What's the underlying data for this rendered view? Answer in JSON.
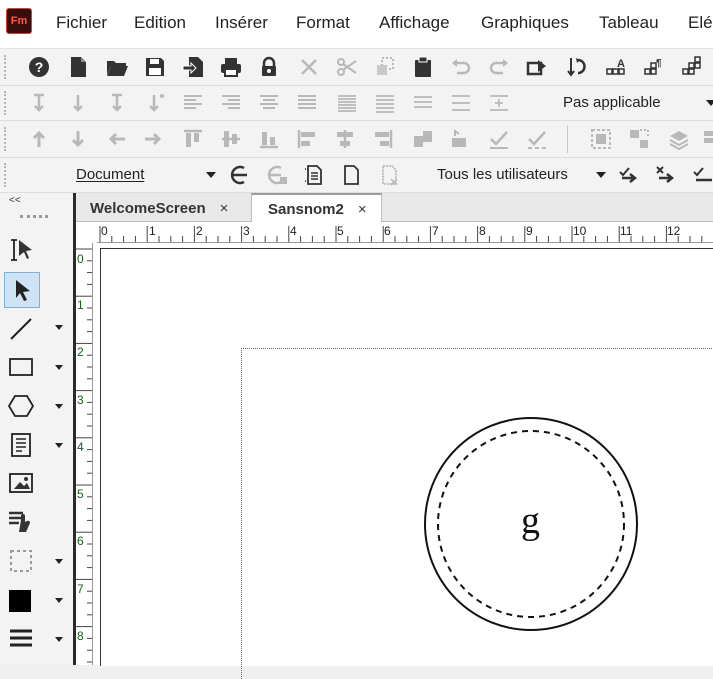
{
  "app": {
    "logo_text": "Fm"
  },
  "menu": {
    "items": [
      "Fichier",
      "Edition",
      "Insérer",
      "Format",
      "Affichage",
      "Graphiques",
      "Tableau",
      "Elé"
    ]
  },
  "toolbar3": {
    "alignment_value": "Pas applicable"
  },
  "toolbar5": {
    "scope_value": "Document",
    "users_value": "Tous les utilisateurs"
  },
  "tabs": [
    {
      "label": "WelcomeScreen",
      "close": "×"
    },
    {
      "label": "Sansnom2",
      "close": "×"
    }
  ],
  "ruler": {
    "horizontal": [
      "0",
      "1",
      "2",
      "3",
      "4",
      "5",
      "6",
      "7",
      "8",
      "9",
      "10",
      "11",
      "12"
    ],
    "vertical": [
      "0",
      "1",
      "2",
      "3",
      "4",
      "5",
      "6",
      "7",
      "8"
    ]
  },
  "document": {
    "circle_text": "g"
  },
  "panel": {
    "collapse_label": "<<"
  }
}
